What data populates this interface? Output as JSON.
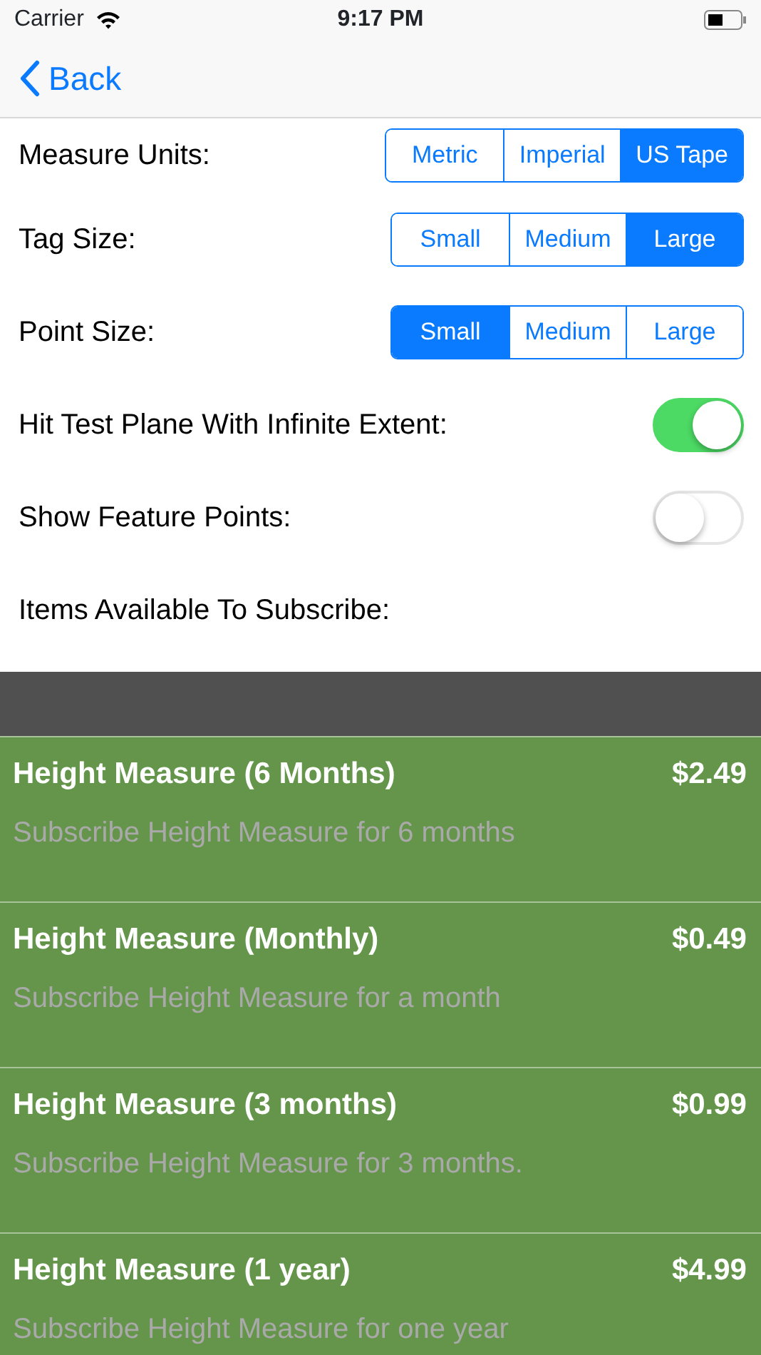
{
  "status_bar": {
    "carrier": "Carrier",
    "time": "9:17 PM"
  },
  "nav": {
    "back": "Back"
  },
  "settings": [
    {
      "kind": "segmented",
      "label": "Measure Units:",
      "options": [
        {
          "label": "Metric",
          "selected": false
        },
        {
          "label": "Imperial",
          "selected": false
        },
        {
          "label": "US Tape",
          "selected": true
        }
      ]
    },
    {
      "kind": "segmented",
      "label": "Tag Size:",
      "options": [
        {
          "label": "Small",
          "selected": false
        },
        {
          "label": "Medium",
          "selected": false
        },
        {
          "label": "Large",
          "selected": true
        }
      ]
    },
    {
      "kind": "segmented",
      "label": "Point Size:",
      "options": [
        {
          "label": "Small",
          "selected": true
        },
        {
          "label": "Medium",
          "selected": false
        },
        {
          "label": "Large",
          "selected": false
        }
      ]
    },
    {
      "kind": "toggle",
      "label": "Hit Test Plane With Infinite Extent:",
      "on": true
    },
    {
      "kind": "toggle",
      "label": "Show Feature Points:",
      "on": false
    },
    {
      "kind": "label",
      "label": "Items Available To Subscribe:"
    }
  ],
  "products": [
    {
      "title": "Height Measure (6 Months)",
      "price": "$2.49",
      "description": "Subscribe Height Measure for 6 months"
    },
    {
      "title": "Height Measure (Monthly)",
      "price": "$0.49",
      "description": "Subscribe Height Measure for a month"
    },
    {
      "title": "Height Measure (3 months)",
      "price": "$0.99",
      "description": "Subscribe Height Measure for 3 months."
    },
    {
      "title": "Height Measure (1 year)",
      "price": "$4.99",
      "description": "Subscribe Height Measure for one year"
    }
  ]
}
